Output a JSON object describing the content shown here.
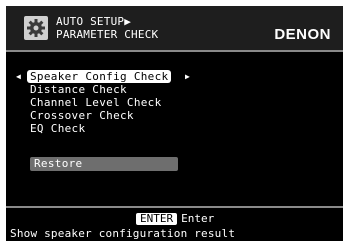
{
  "header": {
    "title_line1": "AUTO SETUP▶",
    "title_line2": "PARAMETER CHECK",
    "brand": "DENON",
    "icon": "gear-icon"
  },
  "menu": {
    "left_arrow": "◀",
    "right_arrow": "▶",
    "items": [
      {
        "label": "Speaker Config Check",
        "selected": true
      },
      {
        "label": "Distance Check",
        "selected": false
      },
      {
        "label": "Channel Level Check",
        "selected": false
      },
      {
        "label": "Crossover Check",
        "selected": false
      },
      {
        "label": "EQ Check",
        "selected": false
      }
    ],
    "restore_label": "Restore"
  },
  "footer": {
    "enter_key": "ENTER",
    "enter_label": "Enter",
    "hint": "Show speaker configuration result"
  },
  "colors": {
    "background": "#000000",
    "text": "#ffffff",
    "highlight_bg": "#ffffff",
    "restore_bg": "#6e6e6e",
    "divider": "#8a8a8a"
  }
}
